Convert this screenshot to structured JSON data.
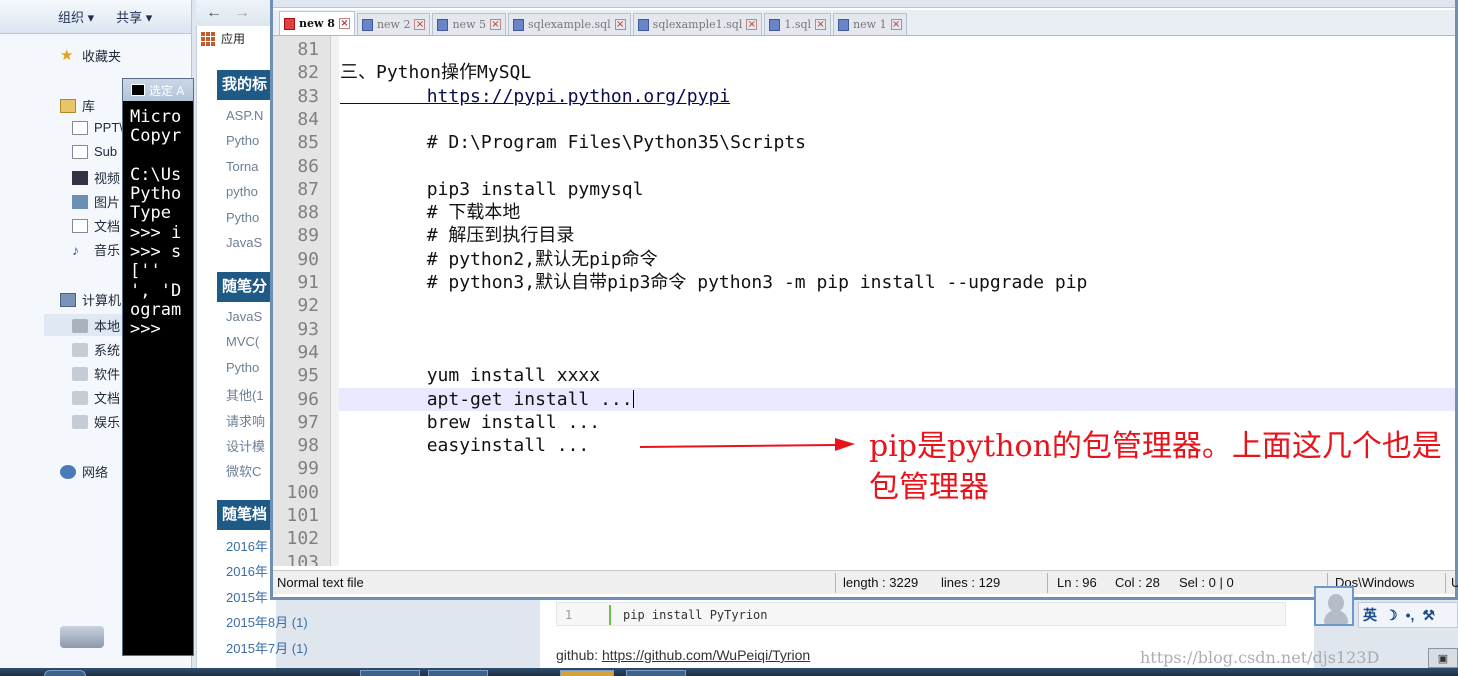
{
  "explorer": {
    "toolbar": {
      "organize": "组织 ▾",
      "share": "共享 ▾"
    },
    "favorites": "收藏夹",
    "libraries": "库",
    "lib_items": [
      "PPT\\",
      "Sub",
      "视频",
      "图片",
      "文档",
      "音乐"
    ],
    "computer": "计算机",
    "computer_items": [
      "本地",
      "系统",
      "软件",
      "文档",
      "娱乐"
    ],
    "network": "网络"
  },
  "cmd": {
    "title": "选定 A",
    "lines": [
      "Micro",
      "Copyr",
      "",
      "C:\\Us",
      "Pytho",
      "Type",
      ">>> i",
      ">>> s",
      "[''",
      "', 'D",
      "ogram",
      ">>>"
    ]
  },
  "blog": {
    "apps_label": "应用",
    "sections": [
      "我的标",
      "随笔分",
      "随笔档"
    ],
    "bookmark_links": [
      "ASP.N",
      "Pytho",
      "Torna",
      "pytho",
      "Pytho",
      "JavaS"
    ],
    "category_links": [
      "JavaS",
      "MVC(",
      "Pytho",
      "其他(1",
      "请求响",
      "设计模",
      "微软C"
    ],
    "archive_links": [
      "2016年",
      "2016年",
      "2015年",
      "2015年8月 (1)",
      "2015年7月 (1)"
    ]
  },
  "npp": {
    "tabs": [
      {
        "label": "new 8",
        "active": true
      },
      {
        "label": "new 2",
        "active": false
      },
      {
        "label": "new 5",
        "active": false
      },
      {
        "label": "sqlexample.sql",
        "active": false
      },
      {
        "label": "sqlexample1.sql",
        "active": false
      },
      {
        "label": "1.sql",
        "active": false
      },
      {
        "label": "new 1",
        "active": false
      }
    ],
    "lines": [
      {
        "n": "81",
        "text": ""
      },
      {
        "n": "82",
        "text": "三、Python操作MySQL"
      },
      {
        "n": "83",
        "text": "        https://pypi.python.org/pypi",
        "url": true
      },
      {
        "n": "84",
        "text": ""
      },
      {
        "n": "85",
        "text": "        # D:\\Program Files\\Python35\\Scripts"
      },
      {
        "n": "86",
        "text": ""
      },
      {
        "n": "87",
        "text": "        pip3 install pymysql"
      },
      {
        "n": "88",
        "text": "        # 下载本地"
      },
      {
        "n": "89",
        "text": "        # 解压到执行目录"
      },
      {
        "n": "90",
        "text": "        # python2,默认无pip命令"
      },
      {
        "n": "91",
        "text": "        # python3,默认自带pip3命令 python3 -m pip install --upgrade pip"
      },
      {
        "n": "92",
        "text": ""
      },
      {
        "n": "93",
        "text": ""
      },
      {
        "n": "94",
        "text": ""
      },
      {
        "n": "95",
        "text": "        yum install xxxx"
      },
      {
        "n": "96",
        "text": "        apt-get install ...",
        "current": true
      },
      {
        "n": "97",
        "text": "        brew install ..."
      },
      {
        "n": "98",
        "text": "        easyinstall ..."
      },
      {
        "n": "99",
        "text": ""
      },
      {
        "n": "100",
        "text": ""
      },
      {
        "n": "101",
        "text": ""
      },
      {
        "n": "102",
        "text": ""
      },
      {
        "n": "103",
        "text": ""
      }
    ],
    "status": {
      "file_type": "Normal text file",
      "length": "length : 3229",
      "lines": "lines : 129",
      "ln": "Ln : 96",
      "col": "Col : 28",
      "sel": "Sel : 0 | 0",
      "eol": "Dos\\Windows",
      "enc": "U"
    }
  },
  "annotation": {
    "text": "pip是python的包管理器。上面这几个也是包管理器",
    "color": "#e8141c"
  },
  "below": {
    "code_line_no": "1",
    "code_text": "pip install PyTyrion",
    "github_label": "github: ",
    "github_url": "https://github.com/WuPeiqi/Tyrion"
  },
  "watermark": "https://blog.csdn.net/djs123D",
  "ime": {
    "lang": "英"
  },
  "tray_label": "▣"
}
